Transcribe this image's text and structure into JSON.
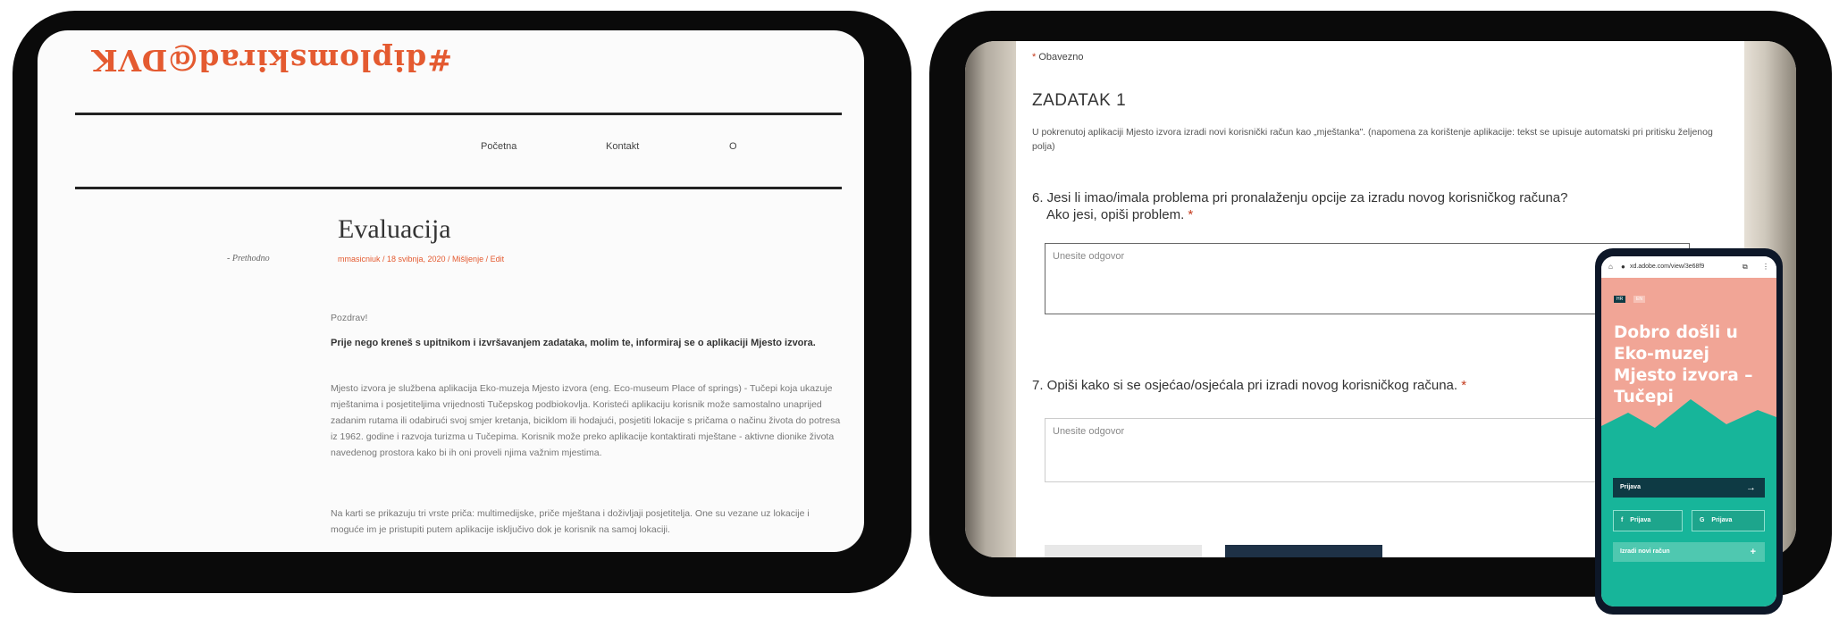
{
  "blog": {
    "logo": "#diplomskirad@DVK",
    "nav": [
      "Početna",
      "Kontakt",
      "O"
    ],
    "title": "Evaluacija",
    "meta": "mmasicniuk  /  18 svibnja, 2020  /  Mišljenje  /  Edit",
    "prev": "- Prethodno",
    "greeting": "Pozdrav!",
    "intro": "Prije nego kreneš s upitnikom i izvršavanjem zadataka, molim te, informiraj se o aplikaciji Mjesto izvora.",
    "p1": "Mjesto izvora je službena aplikacija Eko-muzeja Mjesto izvora (eng. Eco-museum Place of springs) - Tučepi koja ukazuje mještanima i posjetiteljima vrijednosti Tučepskog podbiokovlja. Koristeći aplikaciju korisnik može samostalno unaprijed zadanim rutama ili odabirući svoj smjer kretanja, biciklom ili hodajući, posjetiti lokacije s pričama o načinu života do potresa iz 1962. godine i razvoja turizma u Tučepima. Korisnik može preko aplikacije kontaktirati mještane - aktivne dionike života navedenog prostora kako bi ih oni proveli njima važnim mjestima.",
    "p2": "Na karti se prikazuju tri vrste priča: multimedijske, priče mještana i doživljaji posjetitelja. One su vezane uz lokacije i moguće im je pristupiti putem aplikacije isključivo dok je korisnik na samoj lokaciji."
  },
  "form": {
    "required": "Obavezno",
    "task_title": "ZADATAK 1",
    "task_text": "U pokrenutoj aplikaciji Mjesto izvora izradi novi korisnički račun kao „mještanka\". (napomena za korištenje aplikacije: tekst se upisuje automatski pri pritisku željenog polja)",
    "q6_line1": "6. Jesi li imao/imala problema pri pronalaženju opcije za izradu novog korisničkog računa?",
    "q6_line2": "Ako jesi, opiši problem.",
    "q7": "7. Opiši kako si se osjećao/osjećala pri izradi novog korisničkog računa.",
    "answer_placeholder": "Unesite odgovor"
  },
  "phone": {
    "url": "xd.adobe.com/view/3e68f9",
    "chips": [
      "HR",
      "EN"
    ],
    "hero_title": "Dobro došli u Eko-muzej Mjesto izvora – Tučepi",
    "login": "Prijava",
    "fb": "Prijava",
    "google": "Prijava",
    "register": "Izradi novi račun",
    "colors": {
      "hero": "#f1a596",
      "green": "#17b59a",
      "button": "#0e3a44"
    }
  }
}
